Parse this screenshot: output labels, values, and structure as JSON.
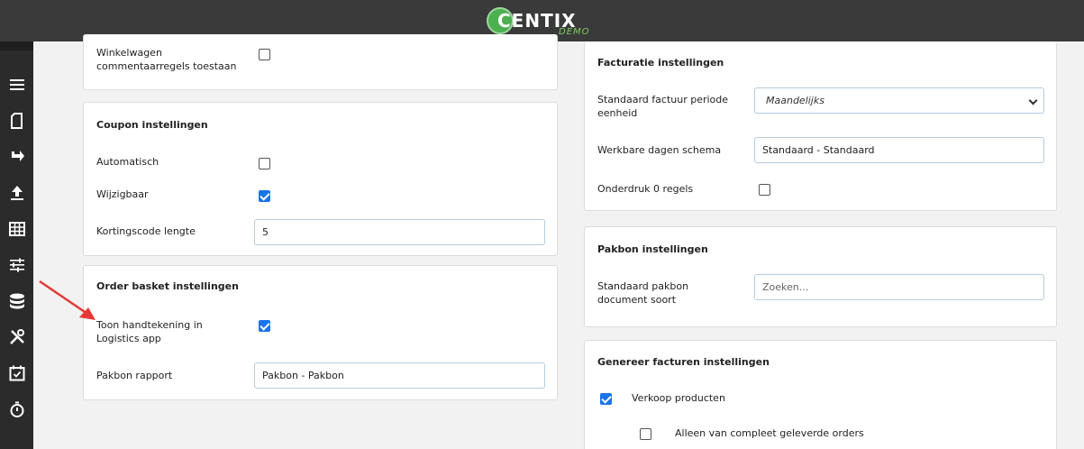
{
  "header": {
    "logo_text": "CENTIX",
    "logo_sub": "DEMO"
  },
  "sidebar": {
    "items": [
      {
        "icon": "menu-icon"
      },
      {
        "icon": "document-icon"
      },
      {
        "icon": "redirect-arrow-icon"
      },
      {
        "icon": "upload-icon"
      },
      {
        "icon": "table-icon"
      },
      {
        "icon": "sliders-icon"
      },
      {
        "icon": "database-icon"
      },
      {
        "icon": "tools-icon"
      },
      {
        "icon": "calendar-check-icon"
      },
      {
        "icon": "stopwatch-icon"
      }
    ]
  },
  "left": {
    "basket_card": {
      "label": "Winkelwagen commentaarregels toestaan",
      "checked": false
    },
    "coupon_card": {
      "title": "Coupon instellingen",
      "automatisch_label": "Automatisch",
      "automatisch_checked": false,
      "wijzigbaar_label": "Wijzigbaar",
      "wijzigbaar_checked": true,
      "kortingscode_label": "Kortingscode lengte",
      "kortingscode_value": "5"
    },
    "order_card": {
      "title": "Order basket instellingen",
      "handtekening_label": "Toon handtekening in Logistics app",
      "handtekening_checked": true,
      "pakbon_label": "Pakbon rapport",
      "pakbon_value": "Pakbon - Pakbon"
    }
  },
  "right": {
    "facturatie_card": {
      "title": "Facturatie instellingen",
      "periode_label": "Standaard factuur periode eenheid",
      "periode_value": "Maandelijks",
      "werkbare_label": "Werkbare dagen schema",
      "werkbare_value": "Standaard - Standaard",
      "onderdruk_label": "Onderdruk 0 regels",
      "onderdruk_checked": false
    },
    "pakbon_card": {
      "title": "Pakbon instellingen",
      "doc_label": "Standaard pakbon document soort",
      "doc_placeholder": "Zoeken..."
    },
    "genereer_card": {
      "title": "Genereer facturen instellingen",
      "verkoop_label": "Verkoop producten",
      "verkoop_checked": true,
      "compleet_label": "Alleen van compleet geleverde orders",
      "compleet_checked": false
    }
  },
  "colors": {
    "accent": "#1a73e8",
    "topbar": "#3a3a3a",
    "sidebar": "#2b2b2b",
    "arrow": "#e53935"
  }
}
